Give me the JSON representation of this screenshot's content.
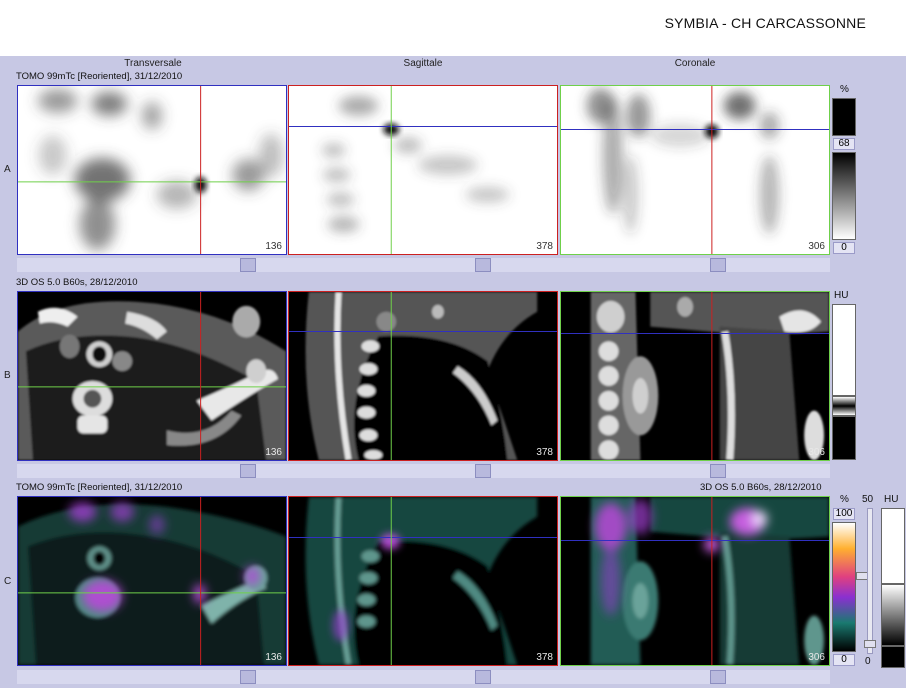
{
  "header": {
    "site": "SYMBIA - CH CARCASSONNE"
  },
  "columns": {
    "transverse": "Transversale",
    "sagittal": "Sagittale",
    "coronal": "Coronale"
  },
  "rows": {
    "a": {
      "label": "A",
      "series": "TOMO 99mTc [Reoriented], 31/12/2010"
    },
    "b": {
      "label": "B",
      "series": "3D  OS  5.0  B60s, 28/12/2010"
    },
    "c": {
      "label": "C",
      "series_left": "TOMO 99mTc [Reoriented], 31/12/2010",
      "series_right": "3D  OS  5.0  B60s, 28/12/2010"
    }
  },
  "slices": {
    "transverse": "136",
    "sagittal": "378",
    "coronal": "306"
  },
  "colorbars": {
    "pet": {
      "unit": "%",
      "upper": "68",
      "lower": "0"
    },
    "ct": {
      "unit": "HU"
    },
    "fusion_pet": {
      "unit": "%",
      "upper": "100",
      "lower": "0"
    },
    "fusion_blend": {
      "upper": "50",
      "lower": "0"
    },
    "fusion_ct": {
      "unit": "HU"
    }
  },
  "colors": {
    "background": "#c7c8e4",
    "transverse_frame": "#3030c0",
    "sagittal_frame": "#cc2020",
    "coronal_frame": "#6fd04a"
  }
}
